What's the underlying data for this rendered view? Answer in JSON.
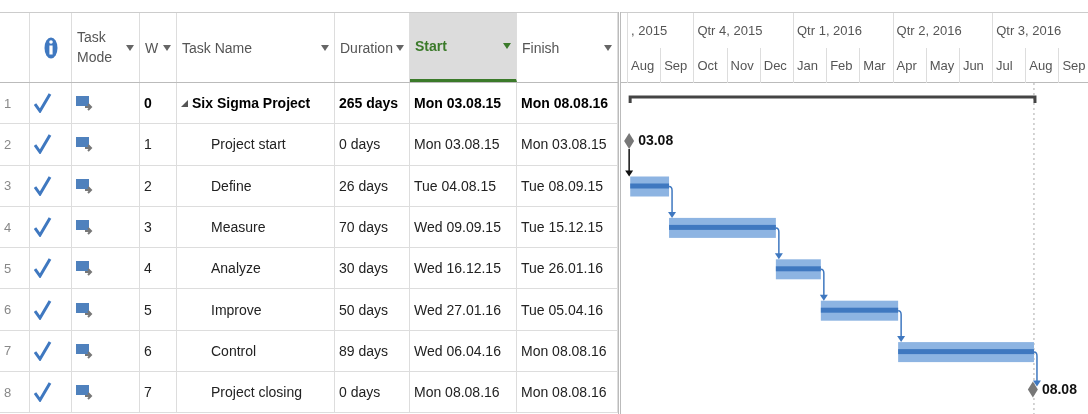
{
  "table": {
    "columns": [
      {
        "kind": "row_number",
        "selected": false,
        "filter": false
      },
      {
        "kind": "indicators",
        "selected": false,
        "filter": false
      },
      {
        "kind": "mode",
        "label": "Task Mode",
        "selected": false,
        "filter": true
      },
      {
        "kind": "wbs",
        "label": "W",
        "selected": false,
        "filter": true
      },
      {
        "kind": "name",
        "label": "Task Name",
        "selected": false,
        "filter": true
      },
      {
        "kind": "duration",
        "label": "Duration",
        "selected": false,
        "filter": true
      },
      {
        "kind": "start",
        "label": "Start",
        "selected": true,
        "filter": true
      },
      {
        "kind": "finish",
        "label": "Finish",
        "selected": false,
        "filter": true
      }
    ],
    "rows": [
      {
        "number": "1",
        "complete": true,
        "wbs": "0",
        "name": "Six Sigma Project",
        "kind": "summary",
        "expanded": true,
        "duration": "265 days",
        "start": "Mon 03.08.15",
        "finish": "Mon 08.08.16"
      },
      {
        "number": "2",
        "complete": true,
        "wbs": "1",
        "name": "Project start",
        "kind": "milestone",
        "duration": "0 days",
        "start": "Mon 03.08.15",
        "finish": "Mon 03.08.15",
        "bar_label": "03.08"
      },
      {
        "number": "3",
        "complete": true,
        "wbs": "2",
        "name": "Define",
        "kind": "task",
        "duration": "26 days",
        "start": "Tue 04.08.15",
        "finish": "Tue 08.09.15"
      },
      {
        "number": "4",
        "complete": true,
        "wbs": "3",
        "name": "Measure",
        "kind": "task",
        "duration": "70 days",
        "start": "Wed 09.09.15",
        "finish": "Tue 15.12.15"
      },
      {
        "number": "5",
        "complete": true,
        "wbs": "4",
        "name": "Analyze",
        "kind": "task",
        "duration": "30 days",
        "start": "Wed 16.12.15",
        "finish": "Tue 26.01.16"
      },
      {
        "number": "6",
        "complete": true,
        "wbs": "5",
        "name": "Improve",
        "kind": "task",
        "duration": "50 days",
        "start": "Wed 27.01.16",
        "finish": "Tue 05.04.16"
      },
      {
        "number": "7",
        "complete": true,
        "wbs": "6",
        "name": "Control",
        "kind": "task",
        "duration": "89 days",
        "start": "Wed 06.04.16",
        "finish": "Mon 08.08.16"
      },
      {
        "number": "8",
        "complete": true,
        "wbs": "7",
        "name": "Project closing",
        "kind": "milestone",
        "duration": "0 days",
        "start": "Mon 08.08.16",
        "finish": "Mon 08.08.16",
        "bar_label": "08.08"
      }
    ]
  },
  "timeline": {
    "quarters": [
      {
        "label": ", 2015",
        "months": [
          "Aug",
          "Sep"
        ]
      },
      {
        "label": "Qtr 4, 2015",
        "months": [
          "Oct",
          "Nov",
          "Dec"
        ]
      },
      {
        "label": "Qtr 1, 2016",
        "months": [
          "Jan",
          "Feb",
          "Mar"
        ]
      },
      {
        "label": "Qtr 2, 2016",
        "months": [
          "Apr",
          "May",
          "Jun"
        ]
      },
      {
        "label": "Qtr 3, 2016",
        "months": [
          "Jul",
          "Aug",
          "Sep"
        ]
      }
    ]
  }
}
